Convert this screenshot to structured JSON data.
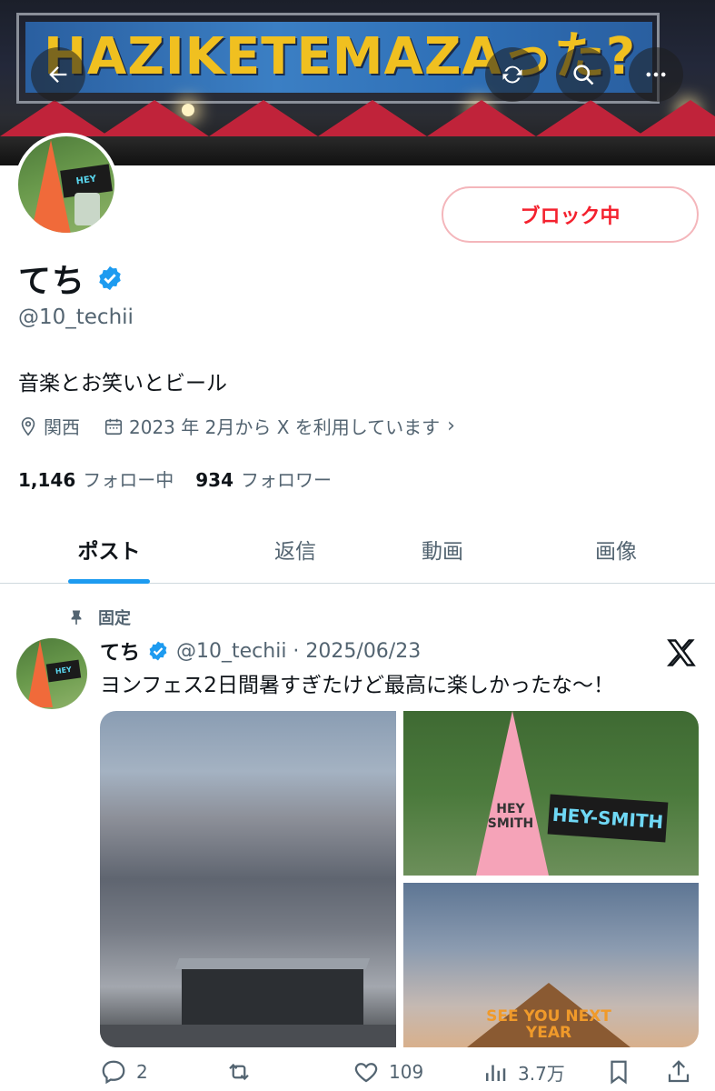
{
  "header": {
    "banner_text": "HAZIKETEMAZAった?",
    "back_icon": "back-arrow-icon",
    "actions": [
      "refresh-icon",
      "search-icon",
      "more-icon"
    ]
  },
  "profile": {
    "block_label": "ブロック中",
    "display_name": "てち",
    "handle": "@10_techii",
    "bio": "音楽とお笑いとビール",
    "location": "関西",
    "joined": "2023 年 2月から X を利用しています",
    "following_count": "1,146",
    "following_label": "フォロー中",
    "followers_count": "934",
    "followers_label": "フォロワー"
  },
  "tabs": [
    {
      "label": "ポスト",
      "active": true
    },
    {
      "label": "返信",
      "active": false
    },
    {
      "label": "動画",
      "active": false
    },
    {
      "label": "画像",
      "active": false
    }
  ],
  "post": {
    "pinned_label": "固定",
    "name": "てち",
    "handle_date": "@10_techii · 2025/06/23",
    "text": "ヨンフェス2日間暑すぎたけど最高に楽しかったな〜！",
    "media": {
      "image2_cone_text": "HEY SMITH",
      "image2_towel_text": "HEY-SMITH",
      "image3_text": "SEE YOU NEXT YEAR"
    },
    "replies": "2",
    "reposts": "",
    "likes": "109",
    "views": "3.7万"
  },
  "colors": {
    "accent": "#1d9bf0",
    "block_red": "#f4212e",
    "secondary_text": "#536471"
  }
}
